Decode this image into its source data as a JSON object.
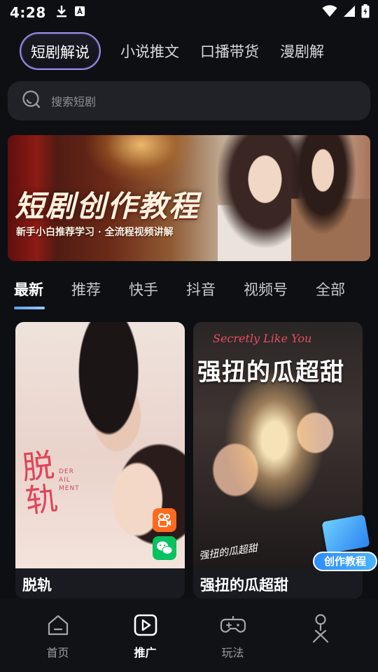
{
  "status_bar": {
    "time": "4:28"
  },
  "top_tabs": [
    {
      "label": "短剧解说",
      "active": true
    },
    {
      "label": "小说推文",
      "active": false
    },
    {
      "label": "口播带货",
      "active": false
    },
    {
      "label": "漫剧解",
      "active": false
    }
  ],
  "search": {
    "placeholder": "搜索短剧"
  },
  "banner": {
    "title": "短剧创作教程",
    "subtitle": "新手小白推荐学习 · 全流程视频讲解"
  },
  "category_tabs": [
    {
      "label": "最新",
      "active": true
    },
    {
      "label": "推荐",
      "active": false
    },
    {
      "label": "快手",
      "active": false
    },
    {
      "label": "抖音",
      "active": false
    },
    {
      "label": "视频号",
      "active": false
    },
    {
      "label": "全部",
      "active": false
    }
  ],
  "cards": [
    {
      "title": "脱轨",
      "poster_title": "脱\n轨",
      "poster_tag": "DER\nAIL\nMENT"
    },
    {
      "title": "强扭的瓜超甜",
      "poster_title": "强扭的瓜超甜",
      "poster_script": "Secretly Like You",
      "poster_handwriting": "强扭的瓜超甜"
    }
  ],
  "floating_badge": {
    "label": "创作教程"
  },
  "bottom_nav": [
    {
      "label": "首页",
      "icon": "home-icon",
      "active": false
    },
    {
      "label": "推广",
      "icon": "play-icon",
      "active": true
    },
    {
      "label": "玩法",
      "icon": "gamepad-icon",
      "active": false
    },
    {
      "label": "",
      "icon": "profile-icon",
      "active": false
    }
  ],
  "colors": {
    "background": "#0e0f12",
    "accent_blue": "#5aa2ff",
    "active_tab_border": "#8f8ee8"
  }
}
